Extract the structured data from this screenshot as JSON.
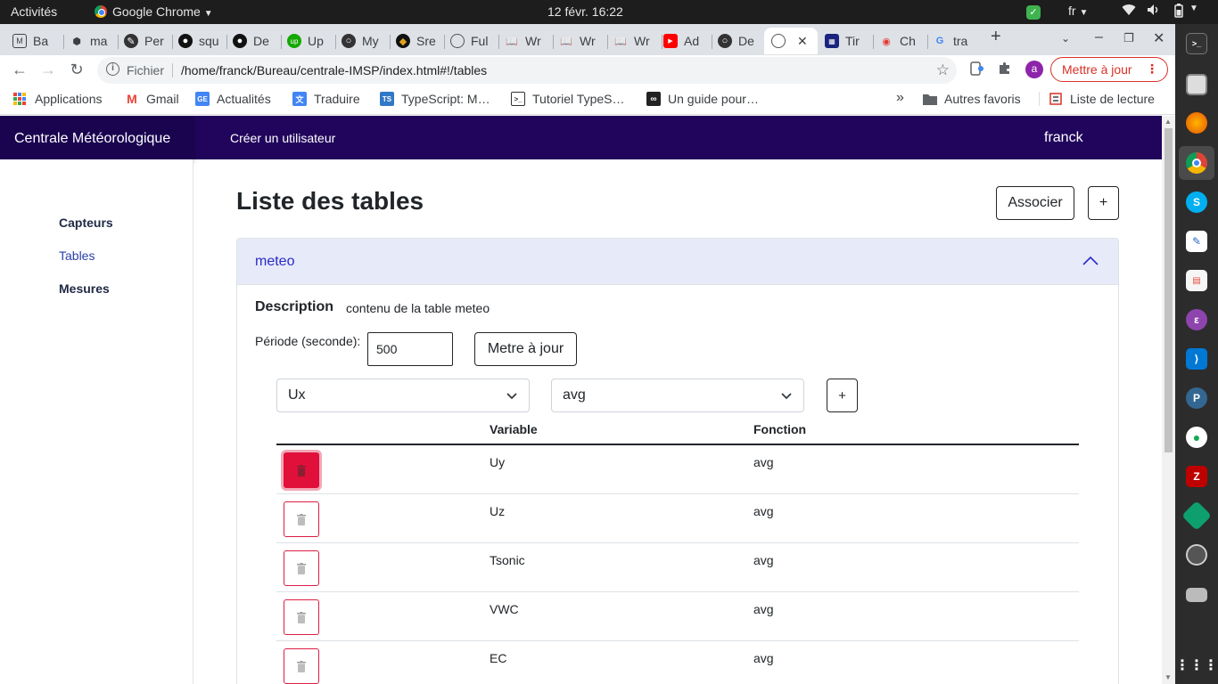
{
  "system_bar": {
    "activities": "Activités",
    "app_name": "Google Chrome",
    "clock": "12 févr.  16:22",
    "language": "fr"
  },
  "tabs": [
    {
      "label": "Ba",
      "icon": "mail-icon",
      "color": "#444444"
    },
    {
      "label": "ma",
      "icon": "cube-icon",
      "color": "#333333"
    },
    {
      "label": "Per",
      "icon": "pen-icon",
      "color": "#333333"
    },
    {
      "label": "squ",
      "icon": "github-icon",
      "color": "#000000"
    },
    {
      "label": "De",
      "icon": "github-icon",
      "color": "#000000"
    },
    {
      "label": "Up",
      "icon": "upwork-icon",
      "color": "#14a800"
    },
    {
      "label": "My",
      "icon": "circle-icon",
      "color": "#333333"
    },
    {
      "label": "Sre",
      "icon": "dark-circle-icon",
      "color": "#111111"
    },
    {
      "label": "Ful",
      "icon": "globe-icon",
      "color": "#555555"
    },
    {
      "label": "Wr",
      "icon": "book-icon",
      "color": "#222222"
    },
    {
      "label": "Wr",
      "icon": "book-icon",
      "color": "#222222"
    },
    {
      "label": "Wr",
      "icon": "book-icon",
      "color": "#222222"
    },
    {
      "label": "Ad",
      "icon": "youtube-icon",
      "color": "#ff0000"
    },
    {
      "label": "De",
      "icon": "circle-icon",
      "color": "#333333"
    },
    {
      "label": "",
      "icon": "globe-icon",
      "color": "#555555",
      "active": true
    },
    {
      "label": "Tir",
      "icon": "chart-icon",
      "color": "#1a237e"
    },
    {
      "label": "Ch",
      "icon": "app-icon",
      "color": "#e53935"
    },
    {
      "label": "tra",
      "icon": "google-icon",
      "color": "#4285f4"
    }
  ],
  "toolbar": {
    "scheme": "Fichier",
    "url": "/home/franck/Bureau/centrale-IMSP/index.html#!/tables",
    "profile_initial": "a",
    "update_label": "Mettre à jour"
  },
  "bookmarks": [
    {
      "label": "Applications",
      "icon": "apps-grid-icon"
    },
    {
      "label": "Gmail",
      "icon": "gmail-icon"
    },
    {
      "label": "Actualités",
      "icon": "news-icon"
    },
    {
      "label": "Traduire",
      "icon": "translate-icon"
    },
    {
      "label": "TypeScript: M…",
      "icon": "typescript-icon"
    },
    {
      "label": "Tutoriel TypeS…",
      "icon": "terminal-icon"
    },
    {
      "label": "Un guide pour…",
      "icon": "infinity-icon"
    }
  ],
  "bookmarks_right": {
    "more": "»",
    "other": "Autres favoris",
    "reading_list": "Liste de lecture"
  },
  "app": {
    "brand": "Centrale Météorologique",
    "nav_create_user": "Créer un utilisateur",
    "username": "franck",
    "sidebar": [
      "Capteurs",
      "Tables",
      "Mesures"
    ],
    "page_title": "Liste des tables",
    "associate_button": "Associer",
    "add_button": "+",
    "accordion": {
      "title": "meteo",
      "description_label": "Description",
      "description_value": "contenu de la table meteo",
      "period_label": "Période (seconde):",
      "period_value": "500",
      "update_button": "Metre à jour",
      "variable_select": "Ux",
      "function_select": "avg",
      "add_row_button": "+",
      "columns": [
        "",
        "Variable",
        "Fonction"
      ],
      "rows": [
        {
          "variable": "Uy",
          "function": "avg"
        },
        {
          "variable": "Uz",
          "function": "avg"
        },
        {
          "variable": "Tsonic",
          "function": "avg"
        },
        {
          "variable": "VWC",
          "function": "avg"
        },
        {
          "variable": "EC",
          "function": "avg"
        }
      ]
    }
  },
  "colors": {
    "navbar": "#21055c",
    "accent": "#2a2bc7",
    "danger": "#dc1e45"
  }
}
